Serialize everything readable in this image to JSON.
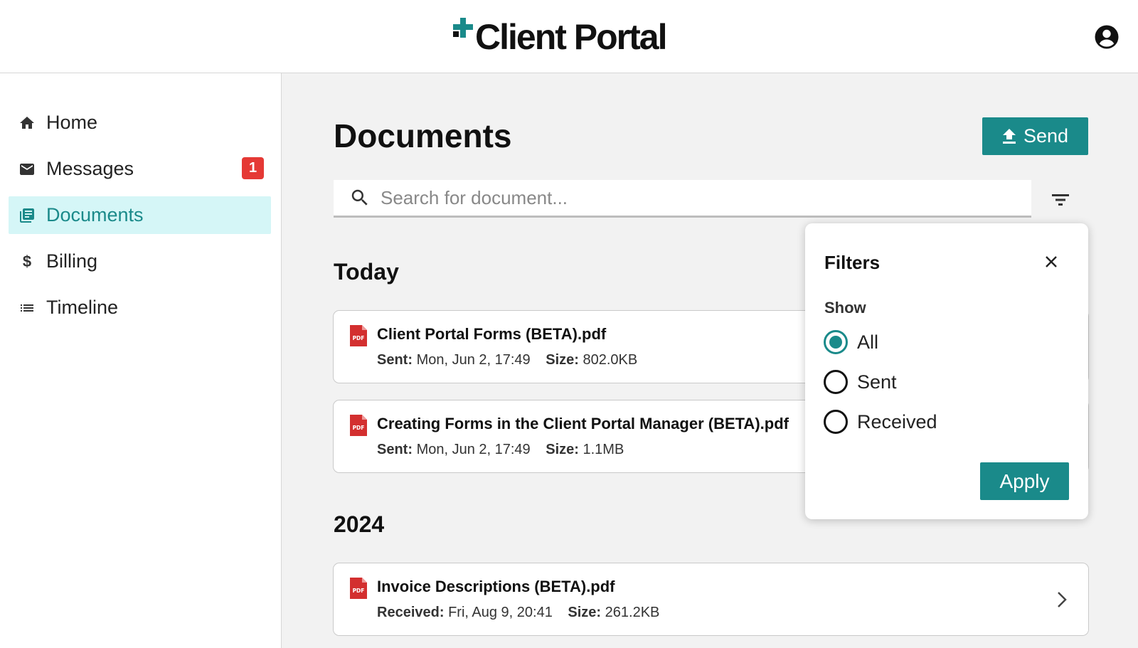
{
  "header": {
    "app_title": "Client Portal",
    "brand_color": "#1a8a8a",
    "account_icon": "account-circle-icon"
  },
  "sidebar": {
    "items": [
      {
        "label": "Home",
        "icon": "home-icon"
      },
      {
        "label": "Messages",
        "icon": "mail-icon",
        "badge": "1"
      },
      {
        "label": "Documents",
        "icon": "documents-icon",
        "active": true
      },
      {
        "label": "Billing",
        "icon": "dollar-icon"
      },
      {
        "label": "Timeline",
        "icon": "list-icon"
      }
    ]
  },
  "main": {
    "title": "Documents",
    "send_label": "Send",
    "search_placeholder": "Search for document...",
    "sections": [
      {
        "heading": "Today",
        "documents": [
          {
            "name": "Client Portal Forms (BETA).pdf",
            "date_label": "Sent:",
            "date": "Mon, Jun 2, 17:49",
            "size_label": "Size:",
            "size": "802.0KB"
          },
          {
            "name": "Creating Forms in the Client Portal Manager (BETA).pdf",
            "date_label": "Sent:",
            "date": "Mon, Jun 2, 17:49",
            "size_label": "Size:",
            "size": "1.1MB"
          }
        ]
      },
      {
        "heading": "2024",
        "documents": [
          {
            "name": "Invoice Descriptions (BETA).pdf",
            "date_label": "Received:",
            "date": "Fri, Aug 9, 20:41",
            "size_label": "Size:",
            "size": "261.2KB"
          }
        ]
      }
    ]
  },
  "filters": {
    "title": "Filters",
    "show_label": "Show",
    "options": [
      {
        "label": "All",
        "checked": true
      },
      {
        "label": "Sent",
        "checked": false
      },
      {
        "label": "Received",
        "checked": false
      }
    ],
    "apply_label": "Apply"
  }
}
